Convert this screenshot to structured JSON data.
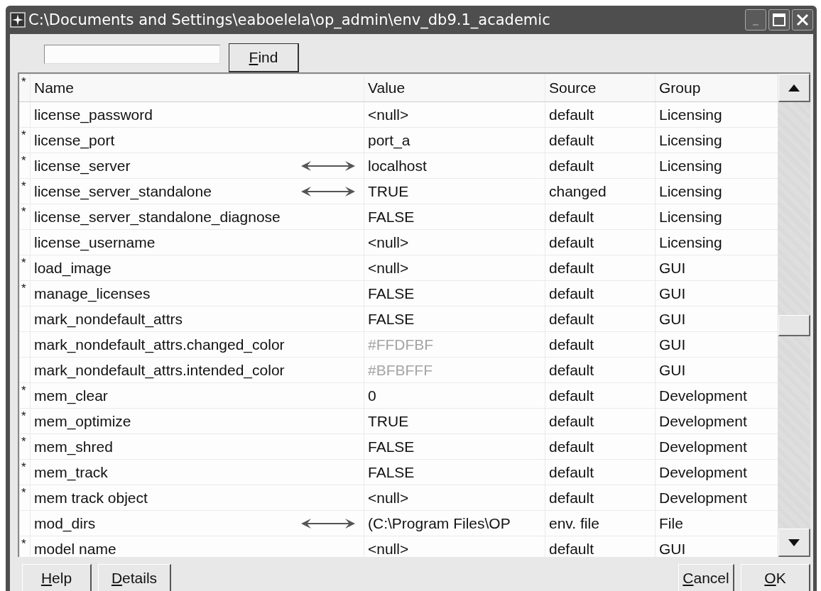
{
  "window": {
    "title": "C:\\Documents and Settings\\eaboelela\\op_admin\\env_db9.1_academic"
  },
  "search": {
    "button": "Find"
  },
  "table": {
    "star_header": "*",
    "columns": [
      "Name",
      "Value",
      "Source",
      "Group"
    ],
    "rows": [
      {
        "starred": false,
        "name": "license_password",
        "arrow": false,
        "value": "<null>",
        "value_dimmed": false,
        "source": "default",
        "group": "Licensing"
      },
      {
        "starred": true,
        "name": "license_port",
        "arrow": false,
        "value": "port_a",
        "value_dimmed": false,
        "source": "default",
        "group": "Licensing"
      },
      {
        "starred": true,
        "name": "license_server",
        "arrow": true,
        "value": "localhost",
        "value_dimmed": false,
        "source": "default",
        "group": "Licensing"
      },
      {
        "starred": true,
        "name": "license_server_standalone",
        "arrow": true,
        "value": "TRUE",
        "value_dimmed": false,
        "source": "changed",
        "group": "Licensing"
      },
      {
        "starred": true,
        "name": "license_server_standalone_diagnose",
        "arrow": false,
        "value": "FALSE",
        "value_dimmed": false,
        "source": "default",
        "group": "Licensing"
      },
      {
        "starred": false,
        "name": "license_username",
        "arrow": false,
        "value": "<null>",
        "value_dimmed": false,
        "source": "default",
        "group": "Licensing"
      },
      {
        "starred": true,
        "name": "load_image",
        "arrow": false,
        "value": "<null>",
        "value_dimmed": false,
        "source": "default",
        "group": "GUI"
      },
      {
        "starred": true,
        "name": "manage_licenses",
        "arrow": false,
        "value": "FALSE",
        "value_dimmed": false,
        "source": "default",
        "group": "GUI"
      },
      {
        "starred": false,
        "name": "mark_nondefault_attrs",
        "arrow": false,
        "value": "FALSE",
        "value_dimmed": false,
        "source": "default",
        "group": "GUI"
      },
      {
        "starred": false,
        "name": "mark_nondefault_attrs.changed_color",
        "arrow": false,
        "value": "#FFDFBF",
        "value_dimmed": true,
        "source": "default",
        "group": "GUI"
      },
      {
        "starred": false,
        "name": "mark_nondefault_attrs.intended_color",
        "arrow": false,
        "value": "#BFBFFF",
        "value_dimmed": true,
        "source": "default",
        "group": "GUI"
      },
      {
        "starred": true,
        "name": "mem_clear",
        "arrow": false,
        "value": "0",
        "value_dimmed": false,
        "source": "default",
        "group": "Development"
      },
      {
        "starred": true,
        "name": "mem_optimize",
        "arrow": false,
        "value": "TRUE",
        "value_dimmed": false,
        "source": "default",
        "group": "Development"
      },
      {
        "starred": true,
        "name": "mem_shred",
        "arrow": false,
        "value": "FALSE",
        "value_dimmed": false,
        "source": "default",
        "group": "Development"
      },
      {
        "starred": true,
        "name": "mem_track",
        "arrow": false,
        "value": "FALSE",
        "value_dimmed": false,
        "source": "default",
        "group": "Development"
      },
      {
        "starred": true,
        "name": "mem track object",
        "arrow": false,
        "value": "<null>",
        "value_dimmed": false,
        "source": "default",
        "group": "Development"
      },
      {
        "starred": false,
        "name": "mod_dirs",
        "arrow": true,
        "value": "(C:\\Program Files\\OP",
        "value_dimmed": false,
        "source": "env. file",
        "group": "File"
      },
      {
        "starred": true,
        "name": "model name",
        "arrow": false,
        "value": "<null>",
        "value_dimmed": false,
        "source": "default",
        "group": "GUI"
      }
    ]
  },
  "buttons_left": [
    "Help",
    "Details"
  ],
  "buttons_right": [
    "Cancel",
    "OK"
  ]
}
